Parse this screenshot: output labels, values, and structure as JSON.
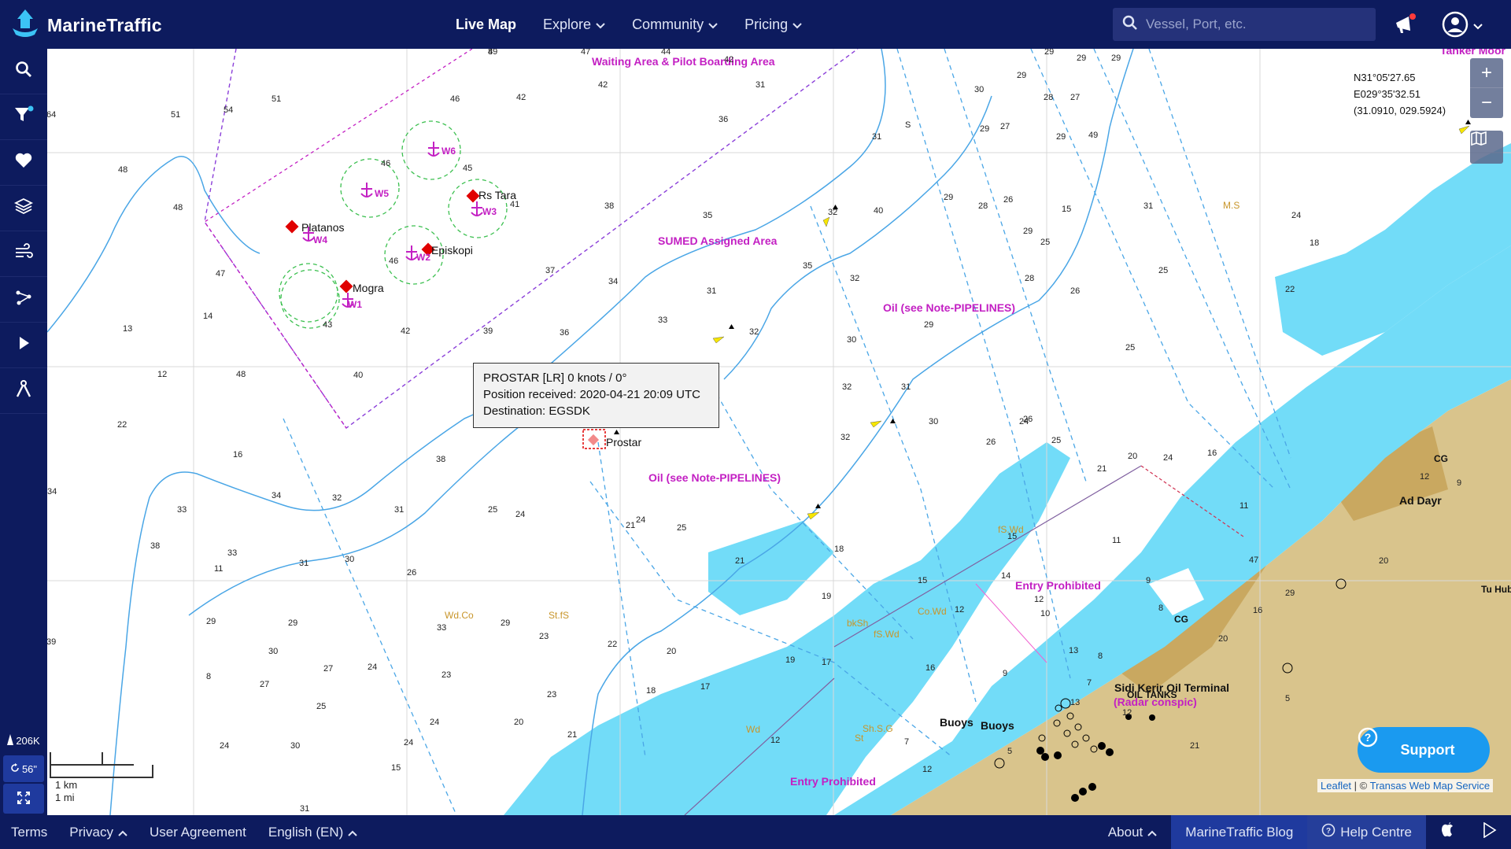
{
  "header": {
    "logo_text": "MarineTraffic",
    "nav": [
      {
        "label": "Live Map",
        "active": true,
        "dropdown": false
      },
      {
        "label": "Explore",
        "active": false,
        "dropdown": true
      },
      {
        "label": "Community",
        "active": false,
        "dropdown": true
      },
      {
        "label": "Pricing",
        "active": false,
        "dropdown": true
      }
    ],
    "search_placeholder": "Vessel, Port, etc.",
    "accent": "#0d1b5e"
  },
  "sidebar": {
    "items": [
      {
        "icon": "search-icon"
      },
      {
        "icon": "filter-icon"
      },
      {
        "icon": "heart-icon"
      },
      {
        "icon": "layers-icon"
      },
      {
        "icon": "wind-icon"
      },
      {
        "icon": "route-icon"
      },
      {
        "icon": "play-icon"
      },
      {
        "icon": "measure-icon"
      }
    ],
    "vessel_count": "206K",
    "refresh_seconds": "56\""
  },
  "map": {
    "popup": {
      "line1": "PROSTAR [LR] 0 knots / 0°",
      "line2": "Position received: 2020-04-21 20:09 UTC",
      "line3": "Destination: EGSDK"
    },
    "coords": {
      "lat": "N31°05'27.65",
      "lon": "E029°35'32.51",
      "decimal": "(31.0910, 029.5924)"
    },
    "labels": {
      "waiting_area": "Waiting  Area & Pilot Boarding Area",
      "sumed": "SUMED Assigned Area",
      "oil_1": "Oil (see Note-PIPELINES)",
      "oil_2": "Oil (see Note-PIPELINES)",
      "rs_tara": "Rs Tara",
      "platanos": "Platanos",
      "episkopi": "Episkopi",
      "mogra": "Mogra",
      "prostar": "Prostar",
      "entry_prohibited_1": "Entry Prohibited",
      "entry_prohibited_2": "Entry Prohibited",
      "sidi_kerir": "Sidi Kerir Oil Terminal",
      "oil_tanks": "OIL TANKS",
      "radar": "(Radar conspic)",
      "ad_dayr": "Ad Dayr",
      "buoys_1": "Buoys",
      "buoys_2": "Buoys",
      "tanker_moor": "Tanker Moor",
      "cg_1": "CG",
      "cg_2": "CG",
      "w1": "W1",
      "w2": "W2",
      "w3": "W3",
      "w4": "W4",
      "w5": "W5",
      "w6": "W6",
      "ms": "M.S",
      "wd_co": "Wd.Co",
      "st_fs": "St.fS",
      "bksh": "bkSh",
      "fswd_1": "fS.Wd",
      "fswd_2": "fS.Wd",
      "cowd": "Co.Wd",
      "shsg": "Sh.S.G",
      "wd": "Wd",
      "st": "St",
      "hub": "Tu Hub"
    },
    "depths": [
      "49",
      "47",
      "44",
      "42",
      "29",
      "29",
      "29",
      "64",
      "51",
      "54",
      "51",
      "46",
      "42",
      "42",
      "31",
      "30",
      "29",
      "28",
      "27",
      "48",
      "36",
      "46",
      "45",
      "S",
      "31",
      "29",
      "27",
      "29",
      "49",
      "48",
      "41",
      "38",
      "35",
      "32",
      "29",
      "28",
      "26",
      "15",
      "31",
      "40",
      "46",
      "47",
      "37",
      "34",
      "31",
      "35",
      "32",
      "29",
      "25",
      "25",
      "24",
      "18",
      "14",
      "43",
      "42",
      "39",
      "36",
      "33",
      "32",
      "30",
      "29",
      "28",
      "26",
      "25",
      "22",
      "13",
      "12",
      "48",
      "40",
      "38",
      "39",
      "34",
      "32",
      "31",
      "26",
      "25",
      "24",
      "22",
      "16",
      "38",
      "32",
      "30",
      "26",
      "24",
      "21",
      "20",
      "16",
      "11",
      "47",
      "34",
      "33",
      "34",
      "32",
      "31",
      "25",
      "24",
      "25",
      "19",
      "15",
      "11",
      "9",
      "8",
      "38",
      "33",
      "31",
      "30",
      "26",
      "24",
      "21",
      "21",
      "18",
      "15",
      "14",
      "12",
      "11",
      "29",
      "33",
      "29",
      "23",
      "22",
      "20",
      "19",
      "17",
      "12",
      "10",
      "39",
      "30",
      "29",
      "27",
      "24",
      "23",
      "23",
      "18",
      "16",
      "13",
      "8",
      "27",
      "25",
      "24",
      "20",
      "17",
      "9",
      "8",
      "24",
      "30",
      "24",
      "21",
      "12",
      "7",
      "13",
      "7",
      "12",
      "5",
      "13",
      "31",
      "15",
      "12",
      "5",
      "21",
      "20",
      "16",
      "29",
      "20",
      "12",
      "9",
      "8"
    ]
  },
  "controls": {
    "zoom_in": "+",
    "zoom_out": "−",
    "support_label": "Support",
    "attribution_leaflet": "Leaflet",
    "attribution_sep": "| ©",
    "attribution_transas": "Transas Web Map Service",
    "scale_km": "1 km",
    "scale_mi": "1 mi"
  },
  "footer": {
    "left": [
      {
        "label": "Terms",
        "caret": false
      },
      {
        "label": "Privacy",
        "caret": true
      },
      {
        "label": "User Agreement",
        "caret": false
      },
      {
        "label": "English (EN)",
        "caret": true
      }
    ],
    "about": "About",
    "blog": "MarineTraffic Blog",
    "help": "Help Centre"
  }
}
